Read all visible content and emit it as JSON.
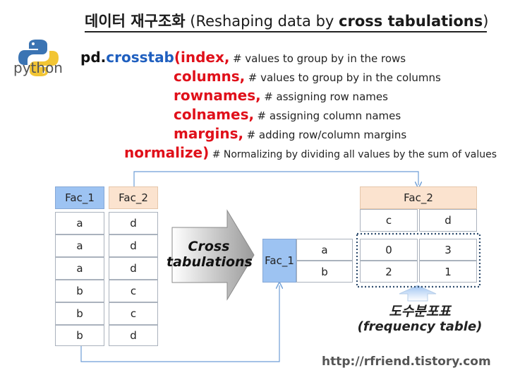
{
  "title": {
    "korean": "데이터 재구조화",
    "paren_open": "(Reshaping data by ",
    "bold_part": "cross tabulations",
    "paren_close": ")"
  },
  "logo": {
    "text": "python"
  },
  "code": {
    "line1": {
      "prefix": "pd.",
      "func": "crosstab",
      "arg": "(index,",
      "comment": "# values to group by in the rows"
    },
    "line2": {
      "arg": "columns,",
      "comment": "# values to group by in the columns"
    },
    "line3": {
      "arg": "rownames,",
      "comment": "# assigning row names"
    },
    "line4": {
      "arg": "colnames,",
      "comment": "# assigning column names"
    },
    "line5": {
      "arg": "margins,",
      "comment": "# adding row/column margins"
    },
    "line6": {
      "arg": "normalize)",
      "comment": "# Normalizing by dividing all values by the sum of values"
    }
  },
  "input_table": {
    "headers": [
      "Fac_1",
      "Fac_2"
    ],
    "fac_1": [
      "a",
      "a",
      "a",
      "b",
      "b",
      "b"
    ],
    "fac_2": [
      "d",
      "d",
      "d",
      "c",
      "c",
      "d"
    ]
  },
  "arrow_label": {
    "line1": "Cross",
    "line2": "tabulations"
  },
  "output_table": {
    "col_header": "Fac_2",
    "col_levels": [
      "c",
      "d"
    ],
    "row_header": "Fac_1",
    "row_levels": [
      "a",
      "b"
    ],
    "counts": [
      [
        "0",
        "3"
      ],
      [
        "2",
        "1"
      ]
    ]
  },
  "frequency_label": {
    "korean": "도수분포표",
    "english": "(frequency table)"
  },
  "url": "http://rfriend.tistory.com",
  "colors": {
    "func_blue": "#1f5fbf",
    "arg_red": "#e0101a",
    "header_blue": "#9dc3f2",
    "header_peach": "#fbe3cf",
    "connector": "#6e9ed6"
  }
}
